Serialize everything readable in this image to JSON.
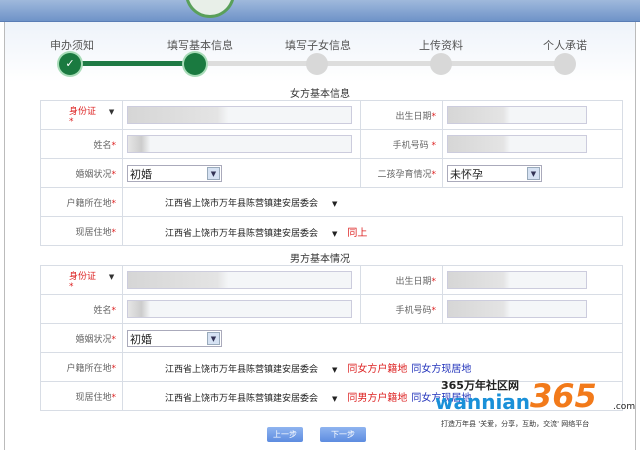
{
  "steps": [
    {
      "label": "申办须知",
      "state": "done"
    },
    {
      "label": "填写基本信息",
      "state": "current"
    },
    {
      "label": "填写子女信息",
      "state": "todo"
    },
    {
      "label": "上传资料",
      "state": "todo"
    },
    {
      "label": "个人承诺",
      "state": "todo"
    }
  ],
  "female": {
    "title": "女方基本信息",
    "id_label": "身份证",
    "birth_label": "出生日期",
    "name_label": "姓名",
    "phone_label": "手机号码",
    "marital_label": "婚姻状况",
    "marital_value": "初婚",
    "second_child_label": "二孩孕育情况",
    "second_child_value": "未怀孕",
    "hukou_label": "户籍所在地",
    "hukou_value": "江西省上饶市万年县陈营镇建安居委会",
    "residence_label": "现居住地",
    "residence_value": "江西省上饶市万年县陈营镇建安居委会",
    "same_above": "同上"
  },
  "male": {
    "title": "男方基本情况",
    "id_label": "身份证",
    "birth_label": "出生日期",
    "name_label": "姓名",
    "phone_label": "手机号码",
    "marital_label": "婚姻状况",
    "marital_value": "初婚",
    "hukou_label": "户籍所在地",
    "hukou_value": "江西省上饶市万年县陈营镇建安居委会",
    "hukou_same_female_hukou": "同女方户籍地",
    "hukou_same_female_res": "同女方现居地",
    "residence_label": "现居住地",
    "residence_value": "江西省上饶市万年县陈营镇建安居委会",
    "res_same_male_hukou": "同男方户籍地",
    "res_same_female_res": "同女方现居地"
  },
  "buttons": {
    "prev": "上一步",
    "next": "下一步"
  },
  "watermark": {
    "line1": "365万年社区网",
    "brand": "wannian",
    "num": "365",
    "tld": ".com",
    "slogan": "打造万年县 '关爱，分享，互助，交流' 网络平台"
  },
  "star": "*",
  "check": "✓",
  "arrow": "▼"
}
